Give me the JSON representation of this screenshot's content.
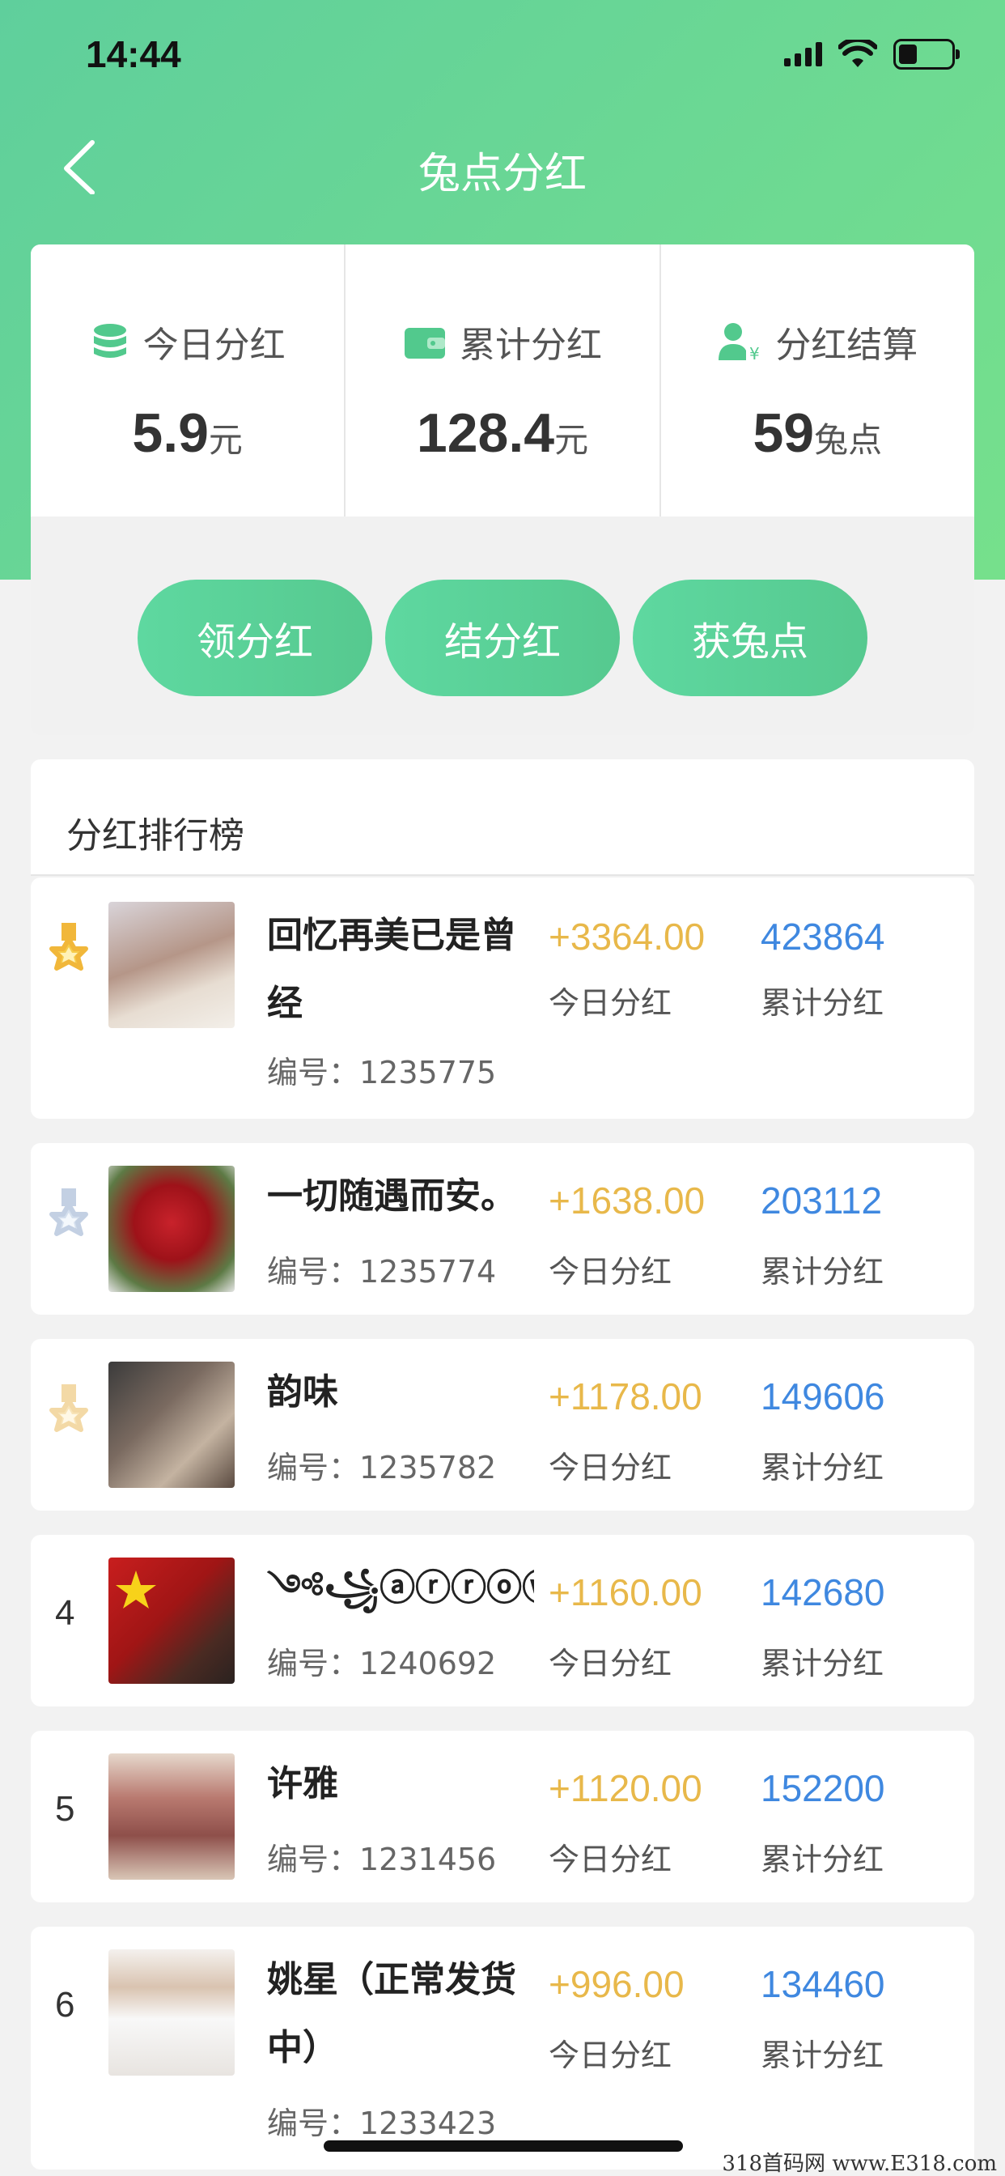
{
  "status": {
    "time": "14:44"
  },
  "nav": {
    "title": "兔点分红"
  },
  "summary": {
    "stats": [
      {
        "icon": "coins-icon",
        "label": "今日分红",
        "value": "5.9",
        "unit": "元"
      },
      {
        "icon": "wallet-icon",
        "label": "累计分红",
        "value": "128.4",
        "unit": "元"
      },
      {
        "icon": "user-yen-icon",
        "label": "分红结算",
        "value": "59",
        "unit": "兔点"
      }
    ],
    "buttons": [
      "领分红",
      "结分红",
      "获兔点"
    ]
  },
  "ranking": {
    "title": "分红排行榜",
    "today_label": "今日分红",
    "total_label": "累计分红",
    "rows": [
      {
        "rank": "1",
        "medal": "gold",
        "name": "回忆再美已是曾经",
        "id": "编号：1235775",
        "today": "+3364.00",
        "total": "423864"
      },
      {
        "rank": "2",
        "medal": "silver",
        "name": "一切随遇而安。",
        "id": "编号：1235774",
        "today": "+1638.00",
        "total": "203112"
      },
      {
        "rank": "3",
        "medal": "bronze",
        "name": "韵味",
        "id": "编号：1235782",
        "today": "+1178.00",
        "total": "149606"
      },
      {
        "rank": "4",
        "medal": "",
        "name": "༺꧁ⓐⓡⓡⓞⓦ꧂༻",
        "id": "编号：1240692",
        "today": "+1160.00",
        "total": "142680"
      },
      {
        "rank": "5",
        "medal": "",
        "name": "许雅",
        "id": "编号：1231456",
        "today": "+1120.00",
        "total": "152200"
      },
      {
        "rank": "6",
        "medal": "",
        "name": "姚星（正常发货中）",
        "id": "编号：1233423",
        "today": "+996.00",
        "total": "134460"
      }
    ]
  },
  "colors": {
    "accent": "#5fcf9c",
    "today": "#e8b84a",
    "total": "#3f88e0"
  },
  "watermark": "318首码网 www.E318.com"
}
